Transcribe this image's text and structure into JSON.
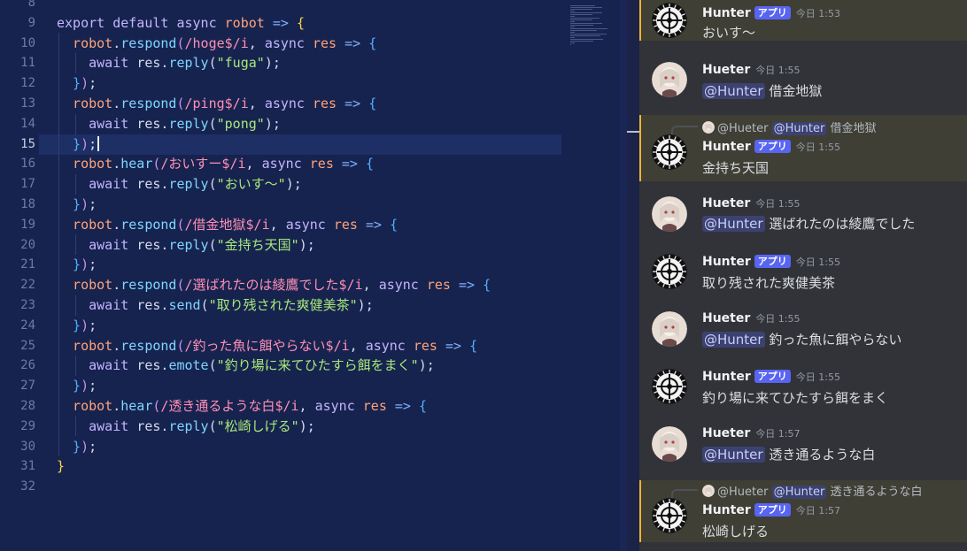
{
  "editor": {
    "cursor_line": 15,
    "lines": [
      {
        "n": "8",
        "tokens": []
      },
      {
        "n": "9",
        "tokens": [
          [
            "kw",
            "export default async "
          ],
          [
            "id",
            "robot"
          ],
          [
            "op",
            " => "
          ],
          [
            "p1",
            "{"
          ]
        ]
      },
      {
        "n": "10",
        "tokens": [
          [
            "id",
            "  robot"
          ],
          [
            "",
            "."
          ],
          [
            "mth",
            "respond"
          ],
          [
            "p2",
            "("
          ],
          [
            "re",
            "/hoge$/i"
          ],
          [
            "",
            ", "
          ],
          [
            "kw",
            "async "
          ],
          [
            "id",
            "res"
          ],
          [
            "op",
            " => "
          ],
          [
            "p3",
            "{"
          ]
        ]
      },
      {
        "n": "11",
        "tokens": [
          [
            "kw",
            "    await "
          ],
          [
            "",
            "res."
          ],
          [
            "mth",
            "reply"
          ],
          [
            "",
            "("
          ],
          [
            "str",
            "\"fuga\""
          ],
          [
            "",
            ");"
          ]
        ]
      },
      {
        "n": "12",
        "tokens": [
          [
            "p3",
            "  }"
          ],
          [
            "p2",
            ")"
          ],
          [
            "",
            ";"
          ]
        ]
      },
      {
        "n": "13",
        "tokens": [
          [
            "id",
            "  robot"
          ],
          [
            "",
            "."
          ],
          [
            "mth",
            "respond"
          ],
          [
            "p2",
            "("
          ],
          [
            "re",
            "/ping$/i"
          ],
          [
            "",
            ", "
          ],
          [
            "kw",
            "async "
          ],
          [
            "id",
            "res"
          ],
          [
            "op",
            " => "
          ],
          [
            "p3",
            "{"
          ]
        ]
      },
      {
        "n": "14",
        "tokens": [
          [
            "kw",
            "    await "
          ],
          [
            "",
            "res."
          ],
          [
            "mth",
            "reply"
          ],
          [
            "",
            "("
          ],
          [
            "str",
            "\"pong\""
          ],
          [
            "",
            ");"
          ]
        ]
      },
      {
        "n": "15",
        "tokens": [
          [
            "p3",
            "  }"
          ],
          [
            "p2",
            ")"
          ],
          [
            "",
            ";"
          ]
        ]
      },
      {
        "n": "16",
        "tokens": [
          [
            "id",
            "  robot"
          ],
          [
            "",
            "."
          ],
          [
            "mth",
            "hear"
          ],
          [
            "p2",
            "("
          ],
          [
            "re",
            "/おいすー$/i"
          ],
          [
            "",
            ", "
          ],
          [
            "kw",
            "async "
          ],
          [
            "id",
            "res"
          ],
          [
            "op",
            " => "
          ],
          [
            "p3",
            "{"
          ]
        ]
      },
      {
        "n": "17",
        "tokens": [
          [
            "kw",
            "    await "
          ],
          [
            "",
            "res."
          ],
          [
            "mth",
            "reply"
          ],
          [
            "",
            "("
          ],
          [
            "str",
            "\"おいす～\""
          ],
          [
            "",
            ");"
          ]
        ]
      },
      {
        "n": "18",
        "tokens": [
          [
            "p3",
            "  }"
          ],
          [
            "p2",
            ")"
          ],
          [
            "",
            ";"
          ]
        ]
      },
      {
        "n": "19",
        "tokens": [
          [
            "id",
            "  robot"
          ],
          [
            "",
            "."
          ],
          [
            "mth",
            "respond"
          ],
          [
            "p2",
            "("
          ],
          [
            "re",
            "/借金地獄$/i"
          ],
          [
            "",
            ", "
          ],
          [
            "kw",
            "async "
          ],
          [
            "id",
            "res"
          ],
          [
            "op",
            " => "
          ],
          [
            "p3",
            "{"
          ]
        ]
      },
      {
        "n": "20",
        "tokens": [
          [
            "kw",
            "    await "
          ],
          [
            "",
            "res."
          ],
          [
            "mth",
            "reply"
          ],
          [
            "",
            "("
          ],
          [
            "str",
            "\"金持ち天国\""
          ],
          [
            "",
            ");"
          ]
        ]
      },
      {
        "n": "21",
        "tokens": [
          [
            "p3",
            "  }"
          ],
          [
            "p2",
            ")"
          ],
          [
            "",
            ";"
          ]
        ]
      },
      {
        "n": "22",
        "tokens": [
          [
            "id",
            "  robot"
          ],
          [
            "",
            "."
          ],
          [
            "mth",
            "respond"
          ],
          [
            "p2",
            "("
          ],
          [
            "re",
            "/選ばれたのは綾鷹でした$/i"
          ],
          [
            "",
            ", "
          ],
          [
            "kw",
            "async "
          ],
          [
            "id",
            "res"
          ],
          [
            "op",
            " => "
          ],
          [
            "p3",
            "{"
          ]
        ]
      },
      {
        "n": "23",
        "tokens": [
          [
            "kw",
            "    await "
          ],
          [
            "",
            "res."
          ],
          [
            "mth",
            "send"
          ],
          [
            "",
            "("
          ],
          [
            "str",
            "\"取り残された爽健美茶\""
          ],
          [
            "",
            ");"
          ]
        ]
      },
      {
        "n": "24",
        "tokens": [
          [
            "p3",
            "  }"
          ],
          [
            "p2",
            ")"
          ],
          [
            "",
            ";"
          ]
        ]
      },
      {
        "n": "25",
        "tokens": [
          [
            "id",
            "  robot"
          ],
          [
            "",
            "."
          ],
          [
            "mth",
            "respond"
          ],
          [
            "p2",
            "("
          ],
          [
            "re",
            "/釣った魚に餌やらない$/i"
          ],
          [
            "",
            ", "
          ],
          [
            "kw",
            "async "
          ],
          [
            "id",
            "res"
          ],
          [
            "op",
            " => "
          ],
          [
            "p3",
            "{"
          ]
        ]
      },
      {
        "n": "26",
        "tokens": [
          [
            "kw",
            "    await "
          ],
          [
            "",
            "res."
          ],
          [
            "mth",
            "emote"
          ],
          [
            "",
            "("
          ],
          [
            "str",
            "\"釣り場に来てひたすら餌をまく\""
          ],
          [
            "",
            ");"
          ]
        ]
      },
      {
        "n": "27",
        "tokens": [
          [
            "p3",
            "  }"
          ],
          [
            "p2",
            ")"
          ],
          [
            "",
            ";"
          ]
        ]
      },
      {
        "n": "28",
        "tokens": [
          [
            "id",
            "  robot"
          ],
          [
            "",
            "."
          ],
          [
            "mth",
            "hear"
          ],
          [
            "p2",
            "("
          ],
          [
            "re",
            "/透き通るような白$/i"
          ],
          [
            "",
            ", "
          ],
          [
            "kw",
            "async "
          ],
          [
            "id",
            "res"
          ],
          [
            "op",
            " => "
          ],
          [
            "p3",
            "{"
          ]
        ]
      },
      {
        "n": "29",
        "tokens": [
          [
            "kw",
            "    await "
          ],
          [
            "",
            "res."
          ],
          [
            "mth",
            "reply"
          ],
          [
            "",
            "("
          ],
          [
            "str",
            "\"松崎しげる\""
          ],
          [
            "",
            ");"
          ]
        ]
      },
      {
        "n": "30",
        "tokens": [
          [
            "p3",
            "  }"
          ],
          [
            "p2",
            ")"
          ],
          [
            "",
            ";"
          ]
        ]
      },
      {
        "n": "31",
        "tokens": [
          [
            "p1",
            "}"
          ]
        ]
      },
      {
        "n": "32",
        "tokens": []
      }
    ]
  },
  "chat": {
    "messages": [
      {
        "author": "Hunter",
        "bot": true,
        "badge": "アプリ",
        "time": "今日 1:53",
        "mention": "",
        "text": "おいす～",
        "reply": null,
        "highlight": true
      },
      {
        "author": "Hueter",
        "bot": false,
        "badge": "",
        "time": "今日 1:55",
        "mention": "@Hunter",
        "text": "借金地獄",
        "reply": null,
        "highlight": false
      },
      {
        "author": "Hunter",
        "bot": true,
        "badge": "アプリ",
        "time": "今日 1:55",
        "mention": "",
        "text": "金持ち天国",
        "reply": {
          "author": "@Hueter",
          "mention": "@Hunter",
          "text": "借金地獄"
        },
        "highlight": true
      },
      {
        "author": "Hueter",
        "bot": false,
        "badge": "",
        "time": "今日 1:55",
        "mention": "@Hunter",
        "text": "選ばれたのは綾鷹でした",
        "reply": null,
        "highlight": false
      },
      {
        "author": "Hunter",
        "bot": true,
        "badge": "アプリ",
        "time": "今日 1:55",
        "mention": "",
        "text": "取り残された爽健美茶",
        "reply": null,
        "highlight": false
      },
      {
        "author": "Hueter",
        "bot": false,
        "badge": "",
        "time": "今日 1:55",
        "mention": "@Hunter",
        "text": "釣った魚に餌やらない",
        "reply": null,
        "highlight": false
      },
      {
        "author": "Hunter",
        "bot": true,
        "badge": "アプリ",
        "time": "今日 1:55",
        "mention": "",
        "text": "釣り場に来てひたすら餌をまく",
        "reply": null,
        "highlight": false
      },
      {
        "author": "Hueter",
        "bot": false,
        "badge": "",
        "time": "今日 1:57",
        "mention": "@Hunter",
        "text": "透き通るような白",
        "reply": null,
        "highlight": false
      },
      {
        "author": "Hunter",
        "bot": true,
        "badge": "アプリ",
        "time": "今日 1:57",
        "mention": "",
        "text": "松崎しげる",
        "reply": {
          "author": "@Hueter",
          "mention": "@Hunter",
          "text": "透き通るような白"
        },
        "highlight": true
      }
    ]
  }
}
